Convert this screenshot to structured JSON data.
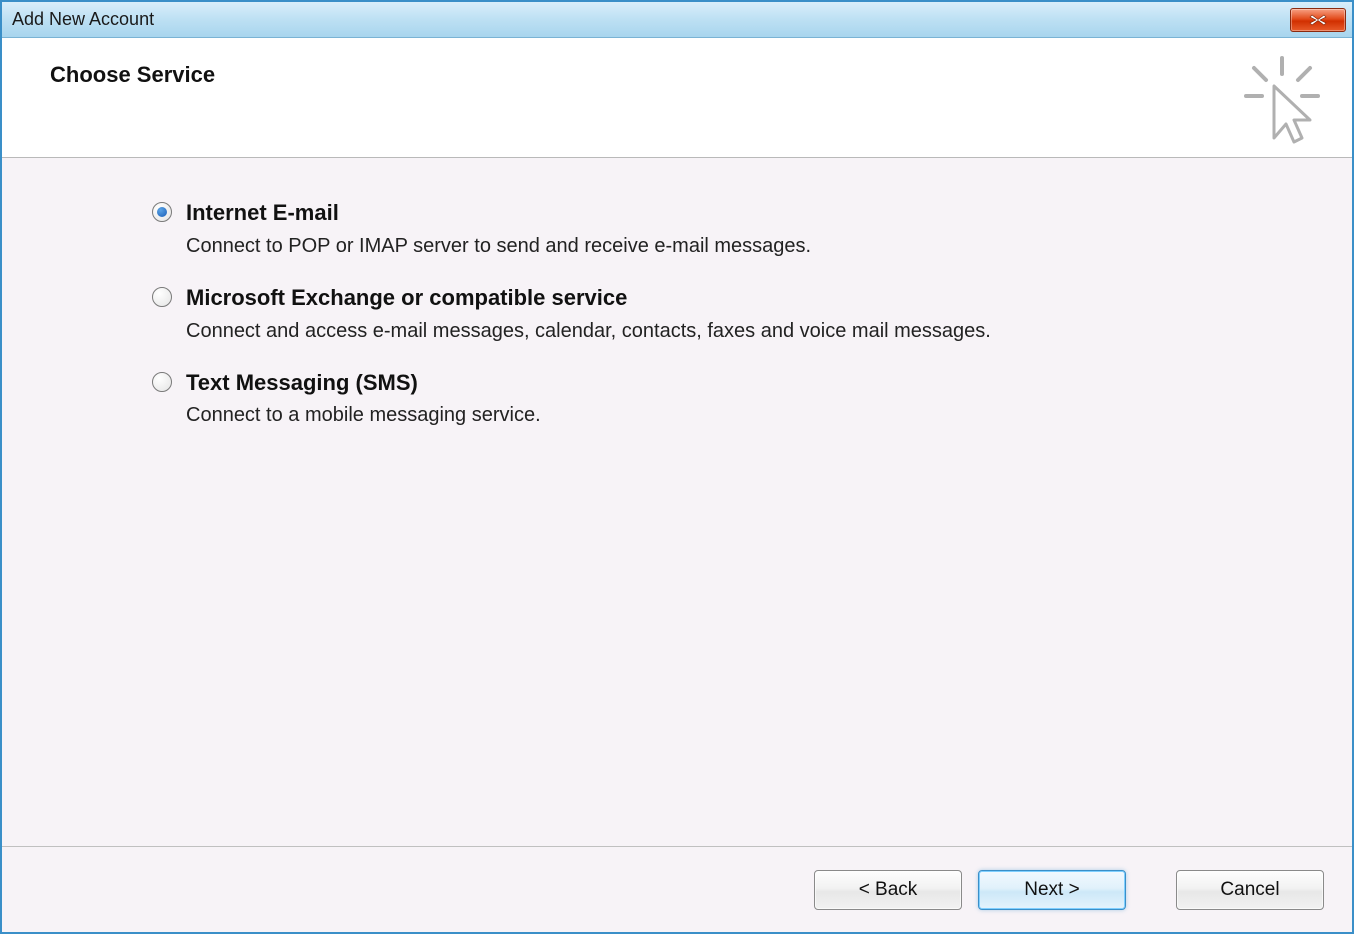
{
  "window": {
    "title": "Add New Account"
  },
  "header": {
    "heading": "Choose Service"
  },
  "options": [
    {
      "id": "internet-email",
      "title": "Internet E-mail",
      "description": "Connect to POP or IMAP server to send and receive e-mail messages.",
      "selected": true
    },
    {
      "id": "exchange",
      "title": "Microsoft Exchange or compatible service",
      "description": "Connect and access e-mail messages, calendar, contacts, faxes and voice mail messages.",
      "selected": false
    },
    {
      "id": "sms",
      "title": "Text Messaging (SMS)",
      "description": "Connect to a mobile messaging service.",
      "selected": false
    }
  ],
  "footer": {
    "back": "< Back",
    "next": "Next >",
    "cancel": "Cancel"
  }
}
